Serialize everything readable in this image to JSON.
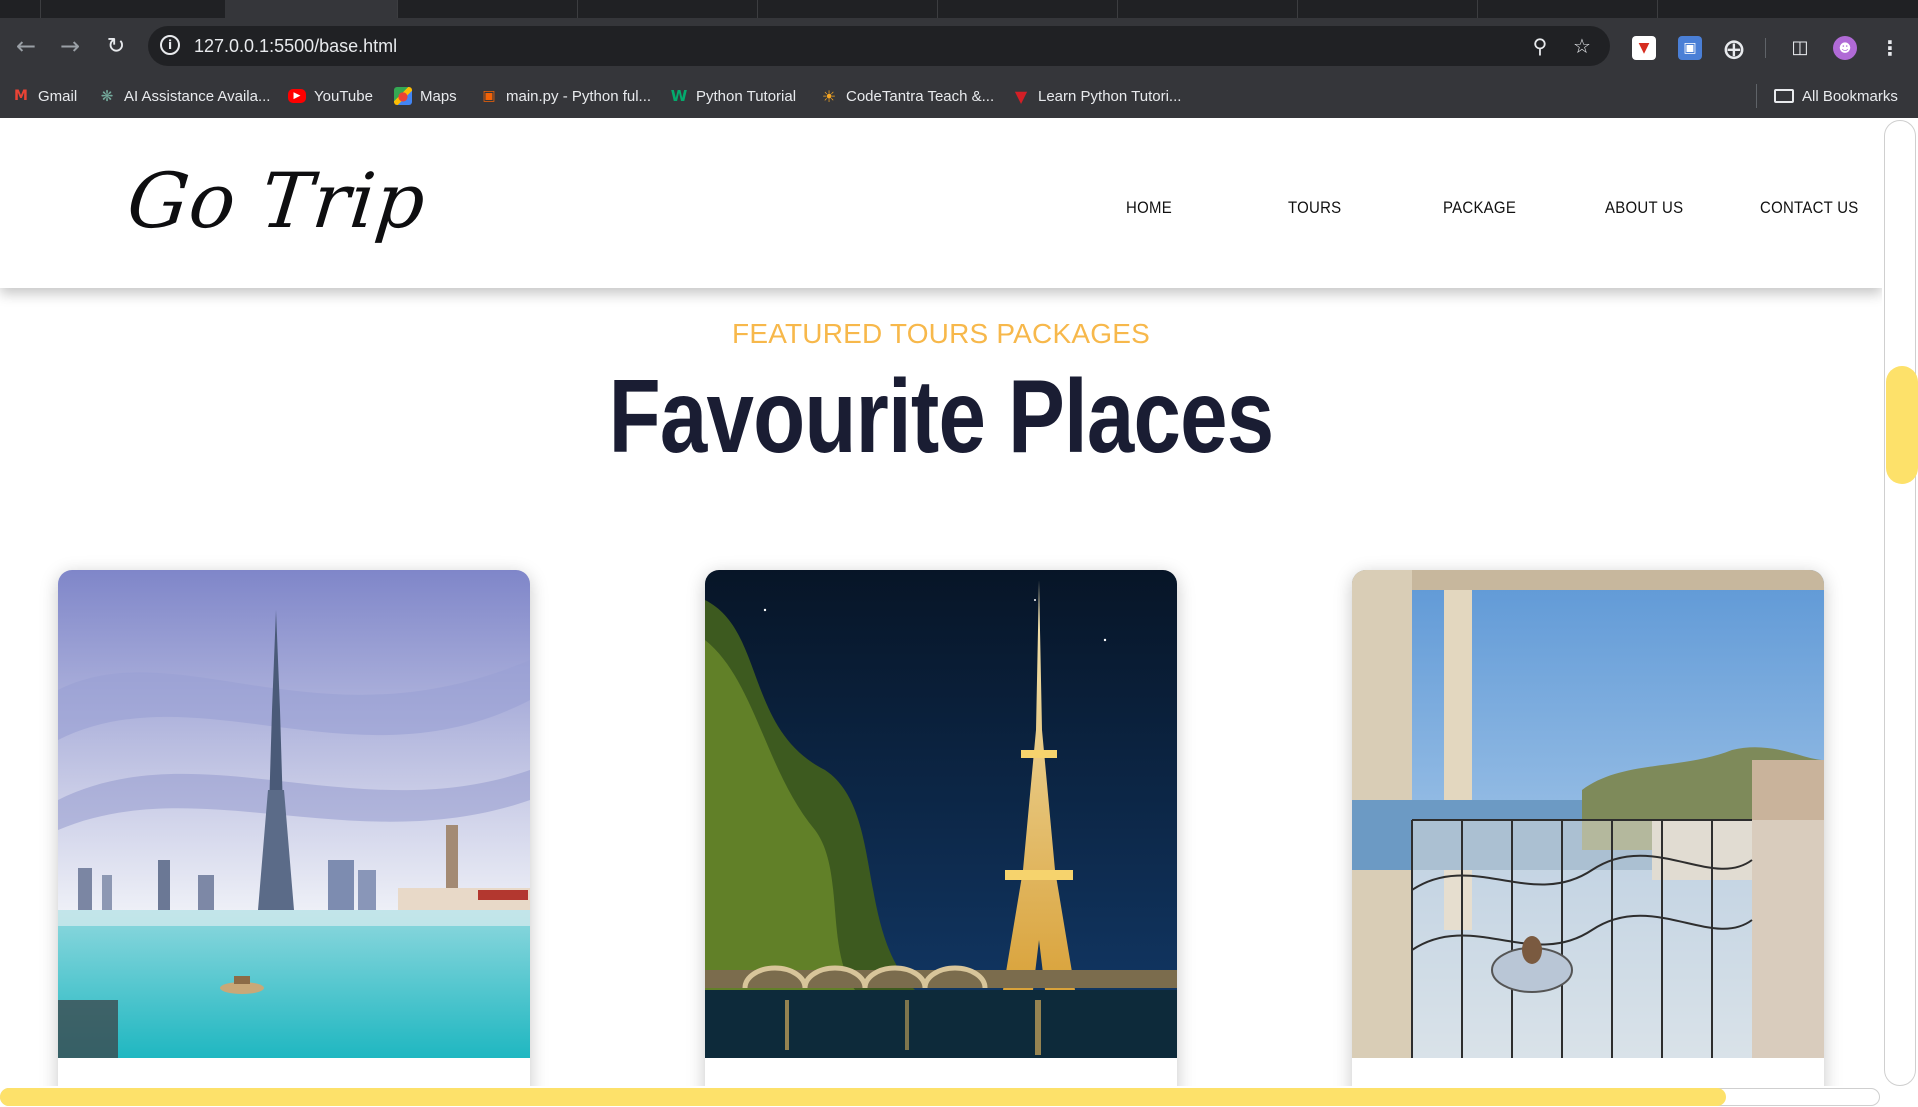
{
  "browser": {
    "url": "127.0.0.1:5500/base.html",
    "bookmarks": [
      {
        "label": "Gmail",
        "icon": "gmail-icon",
        "color": "#ea4335"
      },
      {
        "label": "AI Assistance Availa...",
        "icon": "chatgpt-icon",
        "color": "#74aa9c"
      },
      {
        "label": "YouTube",
        "icon": "youtube-icon",
        "color": "#ff0000"
      },
      {
        "label": "Maps",
        "icon": "maps-icon",
        "color": "#34a853"
      },
      {
        "label": "main.py - Python ful...",
        "icon": "replit-icon",
        "color": "#f26207"
      },
      {
        "label": "Python Tutorial",
        "icon": "w3schools-icon",
        "color": "#04aa6d"
      },
      {
        "label": "CodeTantra Teach &...",
        "icon": "codetantra-icon",
        "color": "#f5a623"
      },
      {
        "label": "Learn Python Tutori...",
        "icon": "tutorialspoint-icon",
        "color": "#d31f26"
      }
    ],
    "all_bookmarks": "All Bookmarks"
  },
  "site": {
    "logo": "Go Trip",
    "nav": [
      "HOME",
      "TOURS",
      "PACKAGE",
      "ABOUT US",
      "CONTACT US"
    ],
    "section_subtitle": "FEATURED TOURS PACKAGES",
    "section_title": "Favourite Places"
  },
  "colors": {
    "accent": "#f7b84b",
    "heading": "#1a1d33",
    "scrollbar_thumb": "#fde16a"
  },
  "cards": [
    {
      "image": "dubai-burj-khalifa-image"
    },
    {
      "image": "paris-eiffel-tower-image"
    },
    {
      "image": "monaco-balcony-image"
    }
  ]
}
